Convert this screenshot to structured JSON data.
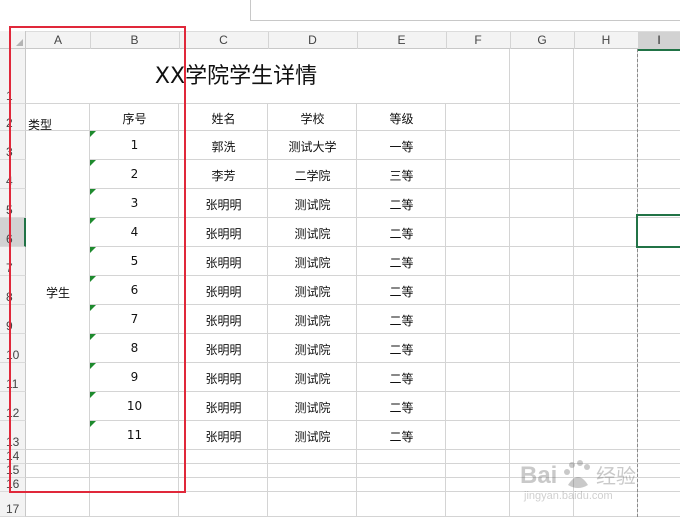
{
  "sheet": {
    "columns": [
      "A",
      "B",
      "C",
      "D",
      "E",
      "F",
      "G",
      "H",
      "I"
    ],
    "selected_column": "I",
    "rows": [
      "1",
      "2",
      "3",
      "4",
      "5",
      "6",
      "7",
      "8",
      "9",
      "10",
      "11",
      "12",
      "13",
      "14",
      "15",
      "16",
      "17"
    ],
    "selected_row": "6",
    "title": "XX学院学生详情",
    "merged_type_value": "学生",
    "headers": {
      "type": "类型",
      "no": "序号",
      "name": "姓名",
      "school": "学校",
      "grade": "等级"
    },
    "records": [
      {
        "no": "1",
        "name": "郭洗",
        "school": "测试大学",
        "grade": "一等"
      },
      {
        "no": "2",
        "name": "李芳",
        "school": "二学院",
        "grade": "三等"
      },
      {
        "no": "3",
        "name": "张明明",
        "school": "测试院",
        "grade": "二等"
      },
      {
        "no": "4",
        "name": "张明明",
        "school": "测试院",
        "grade": "二等"
      },
      {
        "no": "5",
        "name": "张明明",
        "school": "测试院",
        "grade": "二等"
      },
      {
        "no": "6",
        "name": "张明明",
        "school": "测试院",
        "grade": "二等"
      },
      {
        "no": "7",
        "name": "张明明",
        "school": "测试院",
        "grade": "二等"
      },
      {
        "no": "8",
        "name": "张明明",
        "school": "测试院",
        "grade": "二等"
      },
      {
        "no": "9",
        "name": "张明明",
        "school": "测试院",
        "grade": "二等"
      },
      {
        "no": "10",
        "name": "张明明",
        "school": "测试院",
        "grade": "二等"
      },
      {
        "no": "11",
        "name": "张明明",
        "school": "测试院",
        "grade": "二等"
      }
    ]
  },
  "colors": {
    "selection": "#217346",
    "annotation": "#e0283a",
    "number_as_text_marker": "#1e8a2e"
  },
  "watermark": {
    "brand": "Bai",
    "sub": "经验",
    "url": "jingyan.baidu.com"
  }
}
